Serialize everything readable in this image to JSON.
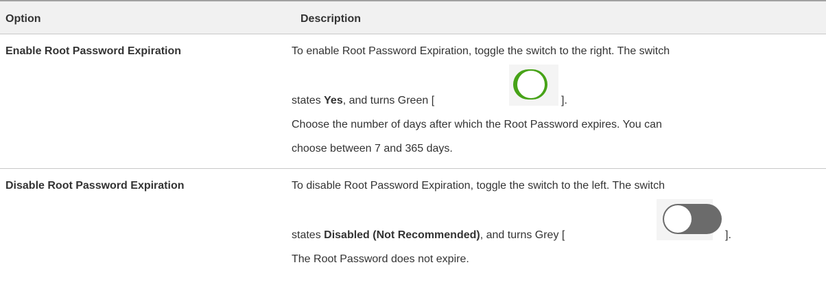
{
  "header": {
    "option": "Option",
    "description": "Description"
  },
  "rows": [
    {
      "option": "Enable Root Password Expiration",
      "line1": "To enable Root Password Expiration, toggle the switch to the right. The switch",
      "line2_pre": "states ",
      "line2_bold": "Yes",
      "line2_mid": ", and turns Green [",
      "line2_post": "].",
      "line3": "Choose the number of days after which the Root Password expires. You can",
      "line4": "choose between 7 and 365 days.",
      "toggle": {
        "state": "on",
        "color": "#47a318"
      }
    },
    {
      "option": "Disable Root Password Expiration",
      "line1": "To disable Root Password Expiration, toggle the switch to the left. The switch",
      "line2_pre": "states ",
      "line2_bold": "Disabled (Not Recommended)",
      "line2_mid": ", and turns Grey [",
      "line2_post": "].",
      "line3": "The Root Password does not expire.",
      "toggle": {
        "state": "off",
        "color": "#6b6b6b"
      }
    }
  ]
}
